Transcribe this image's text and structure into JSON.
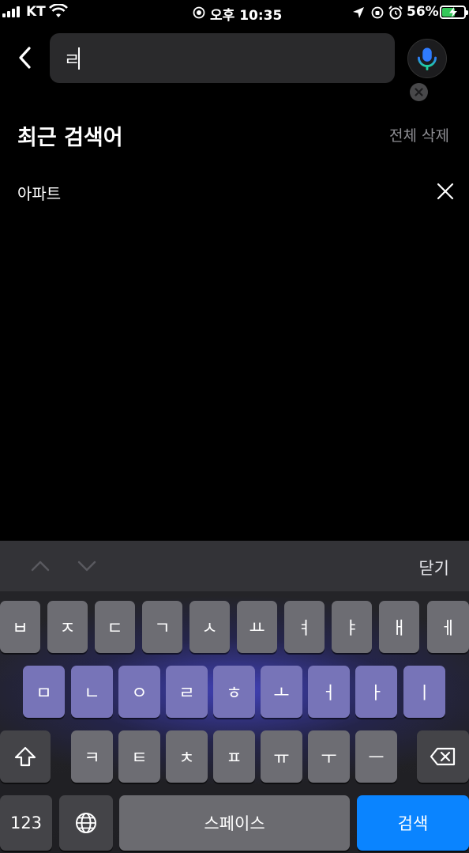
{
  "status_bar": {
    "carrier": "KT",
    "time": "오후 10:35",
    "battery": "56%",
    "battery_level": 0.56,
    "battery_color": "#34c759"
  },
  "search": {
    "query": "ㄹ",
    "back_icon": "chevron-left-icon",
    "clear_icon": "clear-circle-icon",
    "mic_icon": "microphone-icon"
  },
  "recent": {
    "title": "최근 검색어",
    "clear_all": "전체 삭제",
    "items": [
      {
        "label": "아파트"
      }
    ]
  },
  "accessory": {
    "close": "닫기"
  },
  "keyboard": {
    "row1": [
      "ㅂ",
      "ㅈ",
      "ㄷ",
      "ㄱ",
      "ㅅ",
      "ㅛ",
      "ㅕ",
      "ㅑ",
      "ㅐ",
      "ㅔ"
    ],
    "row2": [
      "ㅁ",
      "ㄴ",
      "ㅇ",
      "ㄹ",
      "ㅎ",
      "ㅗ",
      "ㅓ",
      "ㅏ",
      "ㅣ"
    ],
    "row3": [
      "ㅋ",
      "ㅌ",
      "ㅊ",
      "ㅍ",
      "ㅠ",
      "ㅜ",
      "ㅡ"
    ],
    "numbers": "123",
    "space": "스페이스",
    "search": "검색",
    "accent_color": "#0a84ff"
  }
}
